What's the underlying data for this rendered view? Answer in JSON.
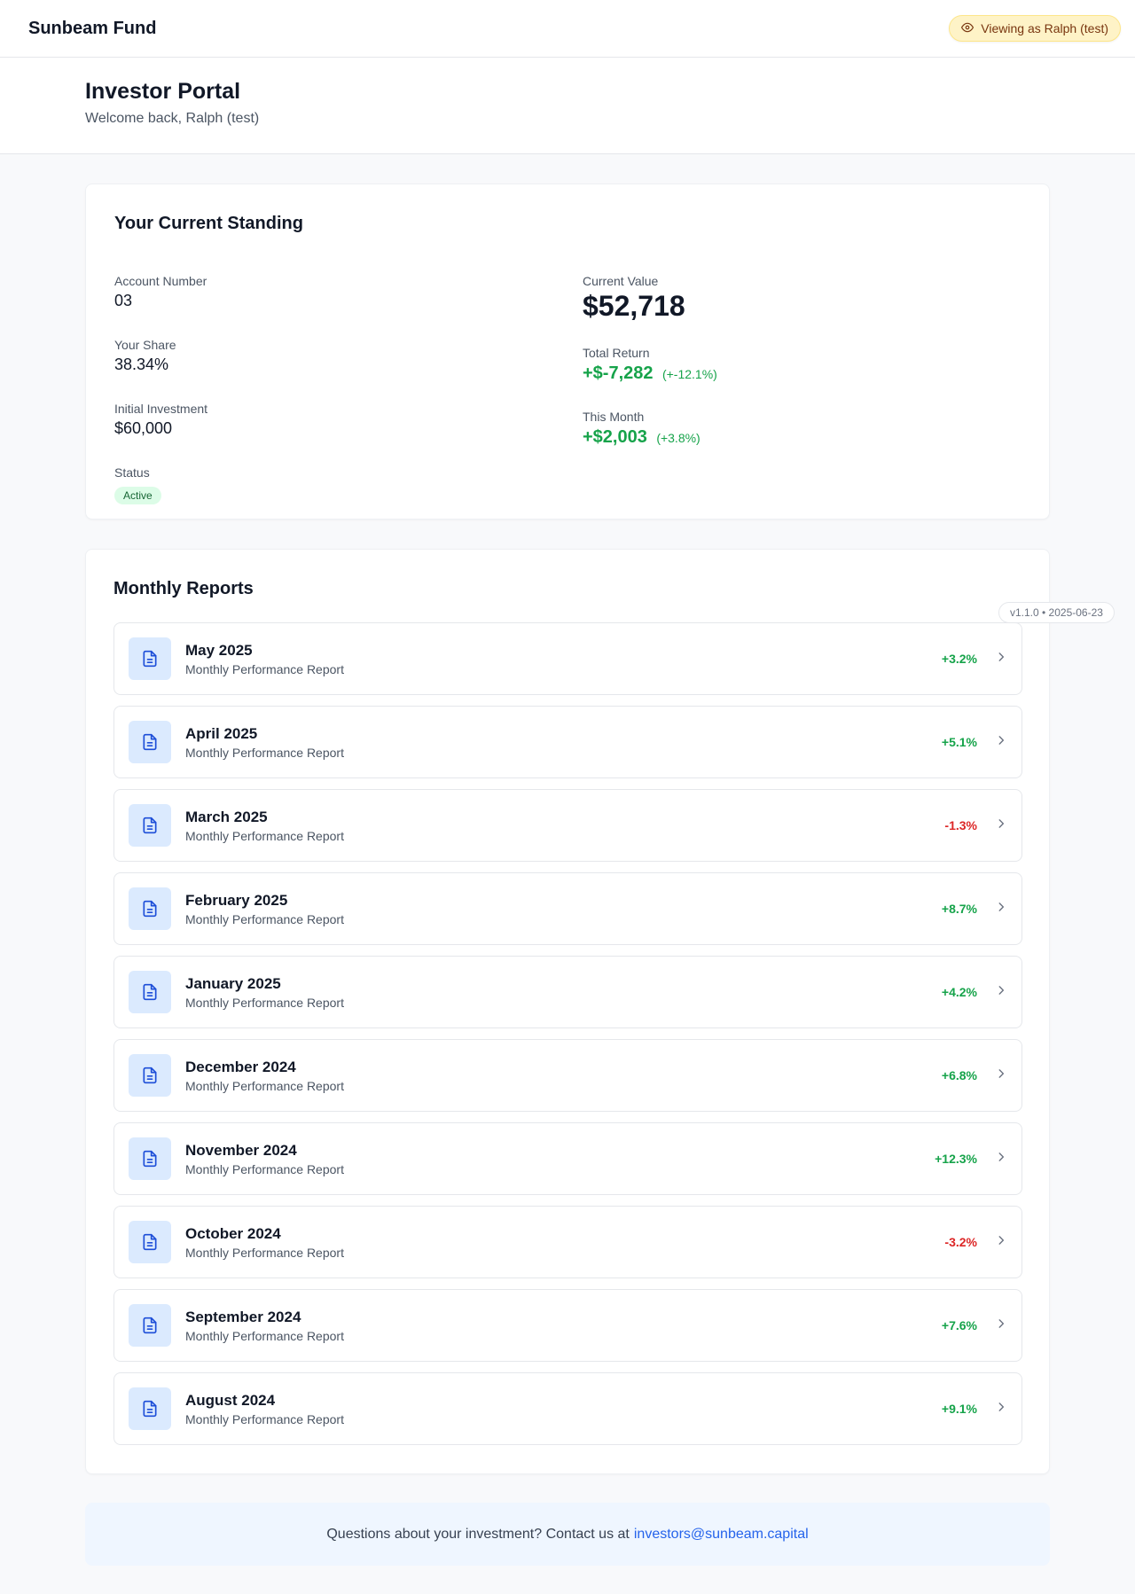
{
  "header": {
    "brand": "Sunbeam Fund",
    "viewing_label": "Viewing as Ralph (test)",
    "viewing_icon": "eye-icon"
  },
  "hero": {
    "title": "Investor Portal",
    "subtitle": "Welcome back, Ralph (test)"
  },
  "standing": {
    "title": "Your Current Standing",
    "account_number_label": "Account Number",
    "account_number": "03",
    "share_label": "Your Share",
    "share": "38.34%",
    "initial_label": "Initial Investment",
    "initial": "$60,000",
    "status_label": "Status",
    "status": "Active",
    "current_value_label": "Current Value",
    "current_value": "$52,718",
    "total_return_label": "Total Return",
    "total_return": "+$-7,282",
    "total_return_pct": "(+-12.1%)",
    "this_month_label": "This Month",
    "this_month": "+$2,003",
    "this_month_pct": "(+3.8%)"
  },
  "reports": {
    "title": "Monthly Reports",
    "items": [
      {
        "title": "May 2025",
        "subtitle": "Monthly Performance Report",
        "change": "+3.2%",
        "positive": true
      },
      {
        "title": "April 2025",
        "subtitle": "Monthly Performance Report",
        "change": "+5.1%",
        "positive": true
      },
      {
        "title": "March 2025",
        "subtitle": "Monthly Performance Report",
        "change": "-1.3%",
        "positive": false
      },
      {
        "title": "February 2025",
        "subtitle": "Monthly Performance Report",
        "change": "+8.7%",
        "positive": true
      },
      {
        "title": "January 2025",
        "subtitle": "Monthly Performance Report",
        "change": "+4.2%",
        "positive": true
      },
      {
        "title": "December 2024",
        "subtitle": "Monthly Performance Report",
        "change": "+6.8%",
        "positive": true
      },
      {
        "title": "November 2024",
        "subtitle": "Monthly Performance Report",
        "change": "+12.3%",
        "positive": true
      },
      {
        "title": "October 2024",
        "subtitle": "Monthly Performance Report",
        "change": "-3.2%",
        "positive": false
      },
      {
        "title": "September 2024",
        "subtitle": "Monthly Performance Report",
        "change": "+7.6%",
        "positive": true
      },
      {
        "title": "August 2024",
        "subtitle": "Monthly Performance Report",
        "change": "+9.1%",
        "positive": true
      }
    ]
  },
  "version": "v1.1.0 • 2025-06-23",
  "footer": {
    "text": "Questions about your investment? Contact us at",
    "email": "investors@sunbeam.capital"
  },
  "colors": {
    "positive": "#16a34a",
    "negative": "#dc2626",
    "accent": "#2563eb",
    "warning_bg": "#fef3c7"
  }
}
